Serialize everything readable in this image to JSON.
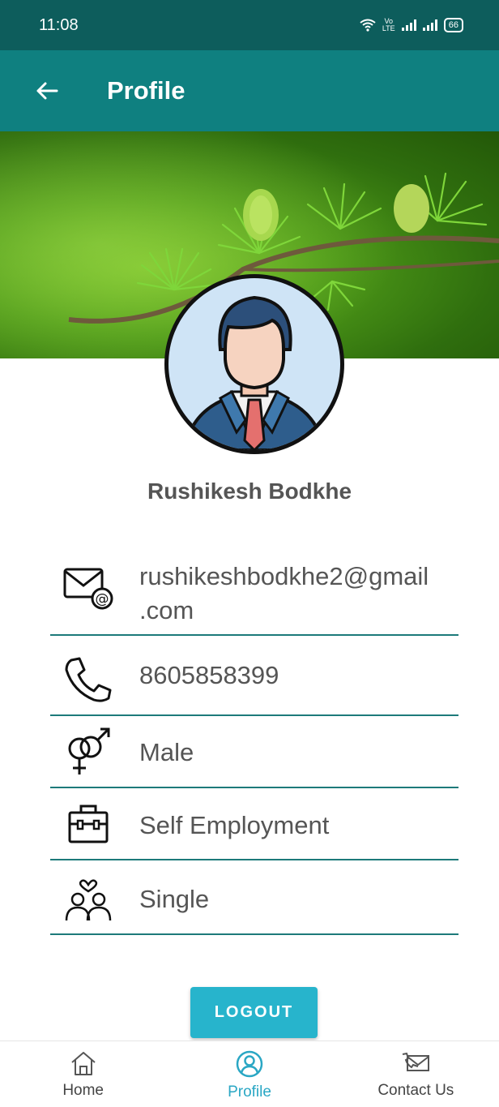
{
  "status_bar": {
    "time": "11:08",
    "network": "Vo LTE",
    "battery": "66"
  },
  "app_bar": {
    "title": "Profile"
  },
  "profile": {
    "name": "Rushikesh Bodkhe",
    "email_line1": "rushikeshbodkhe2@gmail",
    "email_line2": ".com",
    "phone": "8605858399",
    "gender": "Male",
    "occupation": "Self Employment",
    "marital_status": "Single"
  },
  "actions": {
    "logout_label": "LOGOUT"
  },
  "bottom_nav": {
    "items": [
      {
        "label": "Home",
        "icon": "home-icon"
      },
      {
        "label": "Profile",
        "icon": "profile-icon"
      },
      {
        "label": "Contact Us",
        "icon": "contact-icon"
      }
    ],
    "active_index": 1
  },
  "colors": {
    "status_bar": "#0d5d5c",
    "app_bar": "#0f8080",
    "accent": "#27b4cc",
    "divider": "#1d7a7a"
  }
}
